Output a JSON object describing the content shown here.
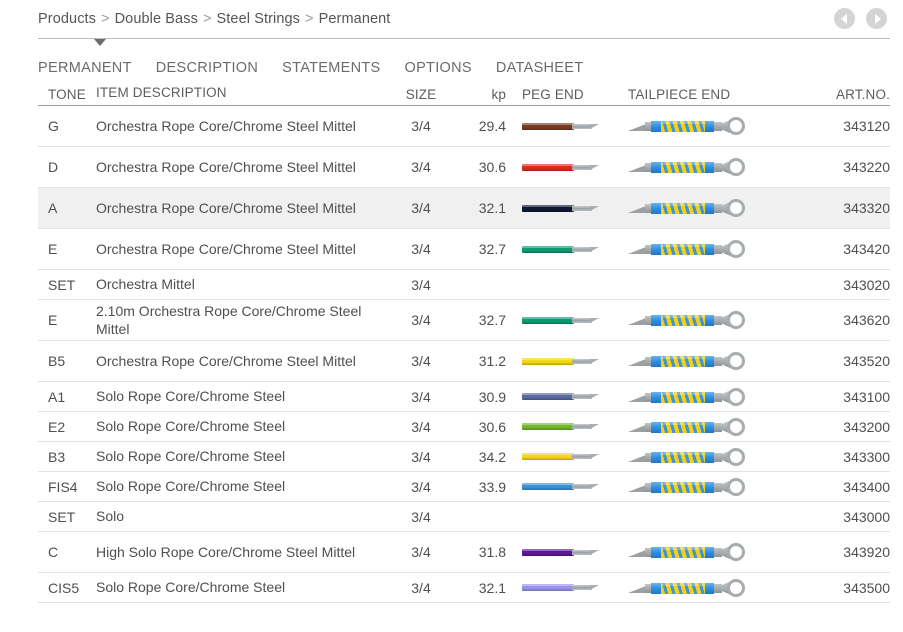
{
  "breadcrumb": {
    "items": [
      "Products",
      "Double Bass",
      "Steel Strings",
      "Permanent"
    ],
    "separator": ">"
  },
  "nav": {
    "prev_label": "◀",
    "next_label": "▶",
    "prev_name": "previous-page-arrow",
    "next_name": "next-page-arrow"
  },
  "tabs": [
    {
      "label": "PERMANENT",
      "active": true
    },
    {
      "label": "DESCRIPTION",
      "active": false
    },
    {
      "label": "STATEMENTS",
      "active": false
    },
    {
      "label": "OPTIONS",
      "active": false
    },
    {
      "label": "DATASHEET",
      "active": false
    }
  ],
  "table": {
    "columns": {
      "tone": "TONE",
      "description": "ITEM DESCRIPTION",
      "size": "SIZE",
      "kp": "kp",
      "peg_end": "PEG END",
      "tailpiece_end": "TAILPIECE END",
      "art_no": "ART.NO."
    },
    "rows": [
      {
        "tone": "G",
        "description": "Orchestra Rope Core/Chrome Steel Mittel",
        "size": "3/4",
        "kp": "29.4",
        "peg_color": "#7b3b22",
        "has_peg": true,
        "has_tail": true,
        "art_no": "343120",
        "highlight": false,
        "tall": true
      },
      {
        "tone": "D",
        "description": "Orchestra Rope Core/Chrome Steel Mittel",
        "size": "3/4",
        "kp": "30.6",
        "peg_color": "#dc2d1c",
        "has_peg": true,
        "has_tail": true,
        "art_no": "343220",
        "highlight": false,
        "tall": true
      },
      {
        "tone": "A",
        "description": "Orchestra Rope Core/Chrome Steel Mittel",
        "size": "3/4",
        "kp": "32.1",
        "peg_color": "#111835",
        "has_peg": true,
        "has_tail": true,
        "art_no": "343320",
        "highlight": true,
        "tall": true
      },
      {
        "tone": "E",
        "description": "Orchestra Rope Core/Chrome Steel Mittel",
        "size": "3/4",
        "kp": "32.7",
        "peg_color": "#0d9a72",
        "has_peg": true,
        "has_tail": true,
        "art_no": "343420",
        "highlight": false,
        "tall": true
      },
      {
        "tone": "SET",
        "description": "Orchestra Mittel",
        "size": "3/4",
        "kp": "",
        "peg_color": "",
        "has_peg": false,
        "has_tail": false,
        "art_no": "343020",
        "highlight": false,
        "tall": false
      },
      {
        "tone": "E",
        "description": "2.10m Orchestra Rope Core/Chrome Steel Mittel",
        "size": "3/4",
        "kp": "32.7",
        "peg_color": "#0d9a72",
        "has_peg": true,
        "has_tail": true,
        "art_no": "343620",
        "highlight": false,
        "tall": true
      },
      {
        "tone": "B5",
        "description": "Orchestra Rope Core/Chrome Steel Mittel",
        "size": "3/4",
        "kp": "31.2",
        "peg_color": "#f5d518",
        "has_peg": true,
        "has_tail": true,
        "art_no": "343520",
        "highlight": false,
        "tall": true
      },
      {
        "tone": "A1",
        "description": "Solo Rope Core/Chrome Steel",
        "size": "3/4",
        "kp": "30.9",
        "peg_color": "#5a6aa0",
        "has_peg": true,
        "has_tail": true,
        "art_no": "343100",
        "highlight": false,
        "tall": false
      },
      {
        "tone": "E2",
        "description": "Solo Rope Core/Chrome Steel",
        "size": "3/4",
        "kp": "30.6",
        "peg_color": "#72b82a",
        "has_peg": true,
        "has_tail": true,
        "art_no": "343200",
        "highlight": false,
        "tall": false
      },
      {
        "tone": "B3",
        "description": "Solo Rope Core/Chrome Steel",
        "size": "3/4",
        "kp": "34.2",
        "peg_color": "#f5d518",
        "has_peg": true,
        "has_tail": true,
        "art_no": "343300",
        "highlight": false,
        "tall": false
      },
      {
        "tone": "FIS4",
        "description": "Solo Rope Core/Chrome Steel",
        "size": "3/4",
        "kp": "33.9",
        "peg_color": "#3b92d8",
        "has_peg": true,
        "has_tail": true,
        "art_no": "343400",
        "highlight": false,
        "tall": false
      },
      {
        "tone": "SET",
        "description": "Solo",
        "size": "3/4",
        "kp": "",
        "peg_color": "",
        "has_peg": false,
        "has_tail": false,
        "art_no": "343000",
        "highlight": false,
        "tall": false
      },
      {
        "tone": "C",
        "description": "High Solo Rope Core/Chrome Steel Mittel",
        "size": "3/4",
        "kp": "31.8",
        "peg_color": "#5c189b",
        "has_peg": true,
        "has_tail": true,
        "art_no": "343920",
        "highlight": false,
        "tall": true
      },
      {
        "tone": "CIS5",
        "description": "Solo Rope Core/Chrome Steel",
        "size": "3/4",
        "kp": "32.1",
        "peg_color": "#9a93ee",
        "has_peg": true,
        "has_tail": true,
        "art_no": "343500",
        "highlight": false,
        "tall": false
      }
    ]
  },
  "colors": {
    "text": "#4f4f4f",
    "rule": "#e2e2e2",
    "header_rule": "#9d9d9d",
    "row_highlight": "#f0f0f0",
    "nav_button": "#d4d4d4"
  }
}
